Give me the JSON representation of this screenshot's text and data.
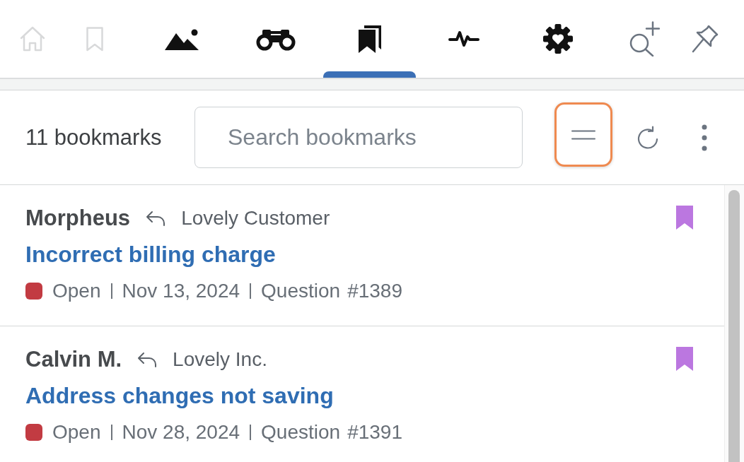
{
  "tabs": [
    {
      "kind": "home",
      "selected": false,
      "disabled": true
    },
    {
      "kind": "bookmark",
      "selected": false,
      "disabled": true
    },
    {
      "kind": "image",
      "selected": false,
      "disabled": false
    },
    {
      "kind": "binoculars",
      "selected": false,
      "disabled": false
    },
    {
      "kind": "bookmarks",
      "selected": true,
      "disabled": false
    },
    {
      "kind": "activity",
      "selected": false,
      "disabled": false
    },
    {
      "kind": "settings",
      "selected": false,
      "disabled": false
    }
  ],
  "actions": [
    {
      "kind": "search-plus"
    },
    {
      "kind": "pin"
    }
  ],
  "toolbar": {
    "count": "11 bookmarks",
    "search": {
      "placeholder": "Search bookmarks"
    },
    "buttons": [
      {
        "kind": "sort",
        "focused": true
      },
      {
        "kind": "refresh",
        "focused": false
      },
      {
        "kind": "more",
        "focused": false
      }
    ]
  },
  "bookmarks": [
    {
      "name": "Morpheus",
      "company": "Lovely Customer",
      "title": "Incorrect billing charge",
      "status": "Open",
      "color": "#c23b42",
      "date": "Nov 13, 2024",
      "type": "Question",
      "number": "#1389",
      "bookmarked": true
    },
    {
      "name": "Calvin M.",
      "company": "Lovely Inc.",
      "title": "Address changes not saving",
      "status": "Open",
      "color": "#c23b42",
      "date": "Nov 28, 2024",
      "type": "Question",
      "number": "#1391",
      "bookmarked": true
    }
  ]
}
